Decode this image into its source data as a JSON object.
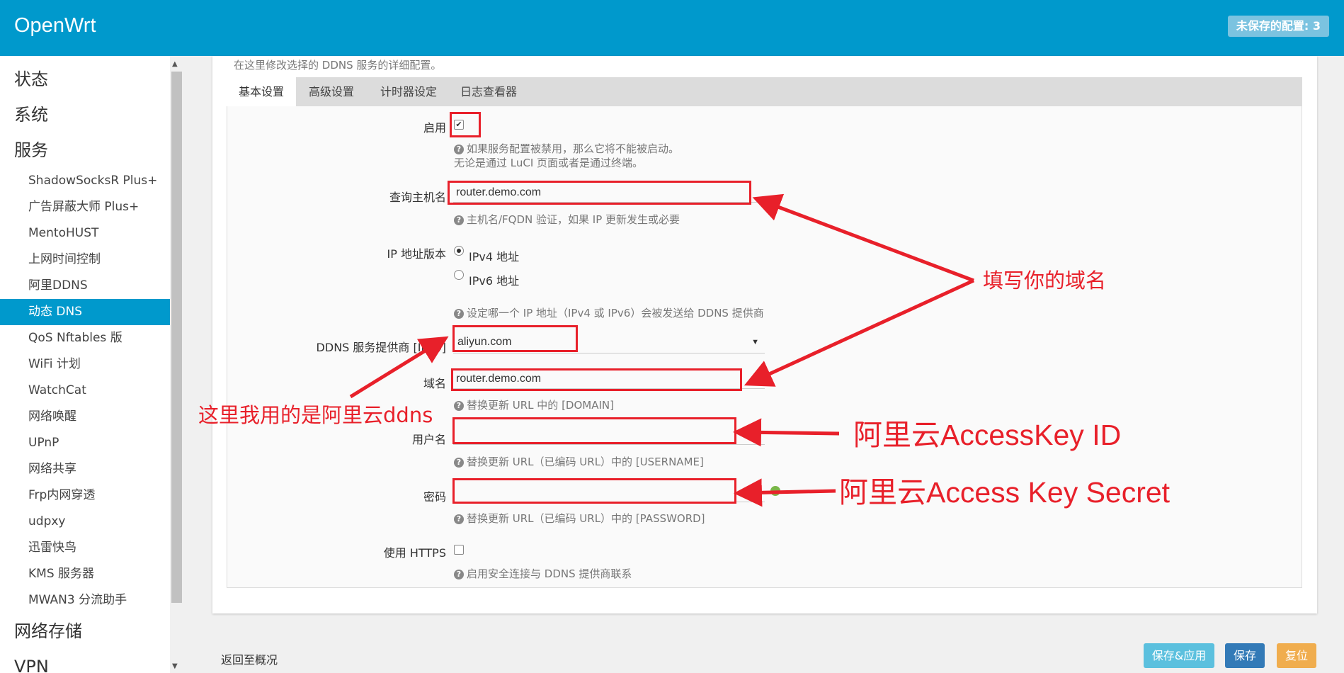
{
  "header": {
    "brand": "OpenWrt",
    "unsaved": "未保存的配置: 3"
  },
  "sidebar": {
    "top_items": [
      "状态",
      "系统",
      "服务"
    ],
    "service_items": [
      "ShadowSocksR Plus+",
      "广告屏蔽大师 Plus+",
      "MentoHUST",
      "上网时间控制",
      "阿里DDNS",
      "动态 DNS",
      "QoS Nftables 版",
      "WiFi 计划",
      "WatchCat",
      "网络唤醒",
      "UPnP",
      "网络共享",
      "Frp内网穿透",
      "udpxy",
      "迅雷快鸟",
      "KMS 服务器",
      "MWAN3 分流助手"
    ],
    "active": "动态 DNS",
    "bottom_items": [
      "网络存储",
      "VPN"
    ]
  },
  "page": {
    "description": "在这里修改选择的 DDNS 服务的详细配置。"
  },
  "tabs": [
    "基本设置",
    "高级设置",
    "计时器设定",
    "日志查看器"
  ],
  "form": {
    "enable_label": "启用",
    "enable_checked": true,
    "enable_help1": "如果服务配置被禁用，那么它将不能被启动。",
    "enable_help2": "无论是通过 LuCI 页面或者是通过终端。",
    "lookup_label": "查询主机名",
    "lookup_value": "router.demo.com",
    "lookup_help": "主机名/FQDN 验证，如果 IP 更新发生或必要",
    "ipver_label": "IP 地址版本",
    "ipv4": "IPv4 地址",
    "ipv6": "IPv6 地址",
    "ipver_selected": "IPv4 地址",
    "ipver_help": "设定哪一个 IP 地址（IPv4 或 IPv6）会被发送给 DDNS 提供商",
    "provider_label": "DDNS 服务提供商 [IPv4]",
    "provider_value": "aliyun.com",
    "domain_label": "域名",
    "domain_value": "router.demo.com",
    "domain_help": "替换更新 URL 中的 [DOMAIN]",
    "username_label": "用户名",
    "username_value": "",
    "username_help": "替换更新 URL（已编码 URL）中的 [USERNAME]",
    "password_label": "密码",
    "password_value": "",
    "password_help": "替换更新 URL（已编码 URL）中的 [PASSWORD]",
    "https_label": "使用 HTTPS",
    "https_checked": false,
    "https_help": "启用安全连接与 DDNS 提供商联系"
  },
  "annotations": {
    "domain_note": "填写你的域名",
    "provider_note": "这里我用的是阿里云ddns",
    "accesskey_id_note": "阿里云AccessKey ID",
    "accesskey_secret_note": "阿里云Access Key Secret"
  },
  "footer": {
    "back": "返回至概况",
    "save_apply": "保存&应用",
    "save": "保存",
    "reset": "复位"
  },
  "colors": {
    "header": "#0099cc",
    "annotation": "#e8202a",
    "save_apply": "#5bc0de",
    "save": "#337ab7",
    "reset": "#f0ad4e"
  }
}
